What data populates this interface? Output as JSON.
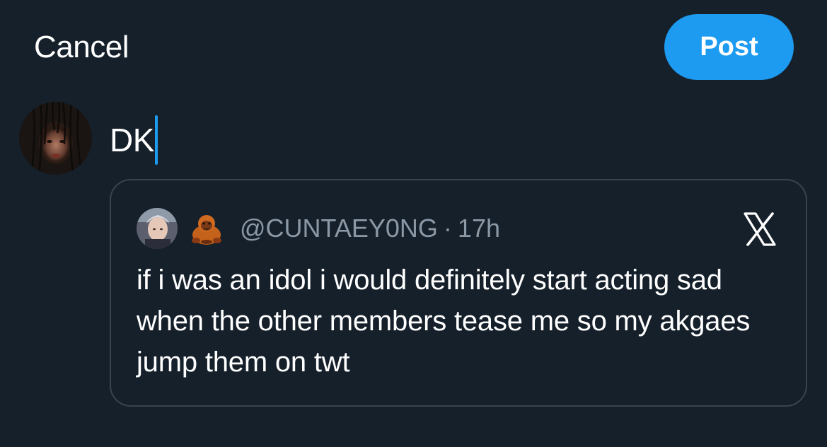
{
  "header": {
    "cancel_label": "Cancel",
    "post_label": "Post"
  },
  "compose": {
    "text": "DK",
    "accent_color": "#1d9bf0"
  },
  "quoted_post": {
    "handle": "@CUNTAEY0NG",
    "separator": "·",
    "time": "17h",
    "emoji_icon": "orangutan-icon",
    "body": "if i was an idol i would definitely start acting sad when the other members tease me so my akgaes jump them on twt"
  },
  "icons": {
    "remove_quote": "x-close-icon",
    "avatar": "user-avatar",
    "quoted_avatar": "quoted-user-avatar"
  },
  "colors": {
    "background": "#15202b",
    "card_border": "#38444d",
    "muted_text": "#8b98a5",
    "post_button": "#1d9bf0"
  }
}
